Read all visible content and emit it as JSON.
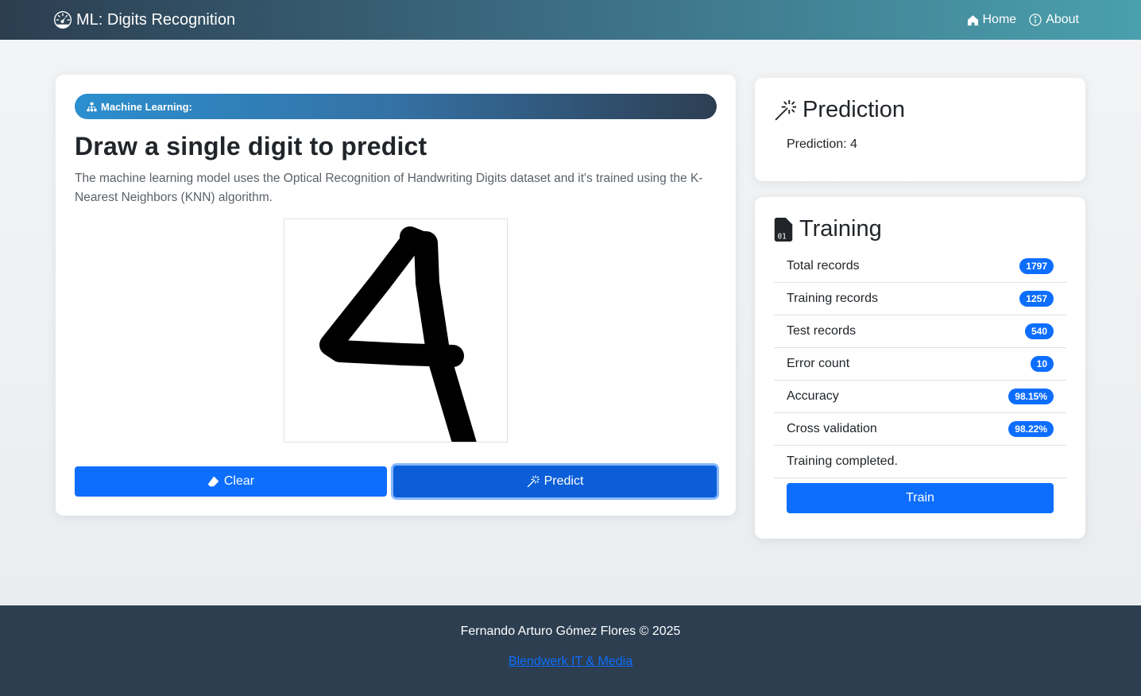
{
  "navbar": {
    "brand": "ML: Digits Recognition",
    "brand_icon": "speedometer-icon",
    "links": [
      {
        "label": "Home",
        "icon": "house-icon"
      },
      {
        "label": "About",
        "icon": "info-circle-icon"
      }
    ]
  },
  "main": {
    "badge": "Machine Learning:",
    "title": "Draw a single digit to predict",
    "description": "The machine learning model uses the Optical Recognition of Handwriting Digits dataset and it's trained using the K-Nearest Neighbors (KNN) algorithm.",
    "clear_label": "Clear",
    "predict_label": "Predict"
  },
  "prediction": {
    "title": "Prediction",
    "text": "Prediction: 4"
  },
  "training": {
    "title": "Training",
    "items": [
      {
        "label": "Total records",
        "value": "1797"
      },
      {
        "label": "Training records",
        "value": "1257"
      },
      {
        "label": "Test records",
        "value": "540"
      },
      {
        "label": "Error count",
        "value": "10"
      },
      {
        "label": "Accuracy",
        "value": "98.15%"
      },
      {
        "label": "Cross validation",
        "value": "98.22%"
      }
    ],
    "status": "Training completed.",
    "train_label": "Train"
  },
  "footer": {
    "text": "Fernando Arturo Gómez Flores © 2025",
    "link": "Blendwerk IT & Media"
  },
  "colors": {
    "primary": "#0d6efd",
    "footer_bg": "#2c3e50"
  }
}
